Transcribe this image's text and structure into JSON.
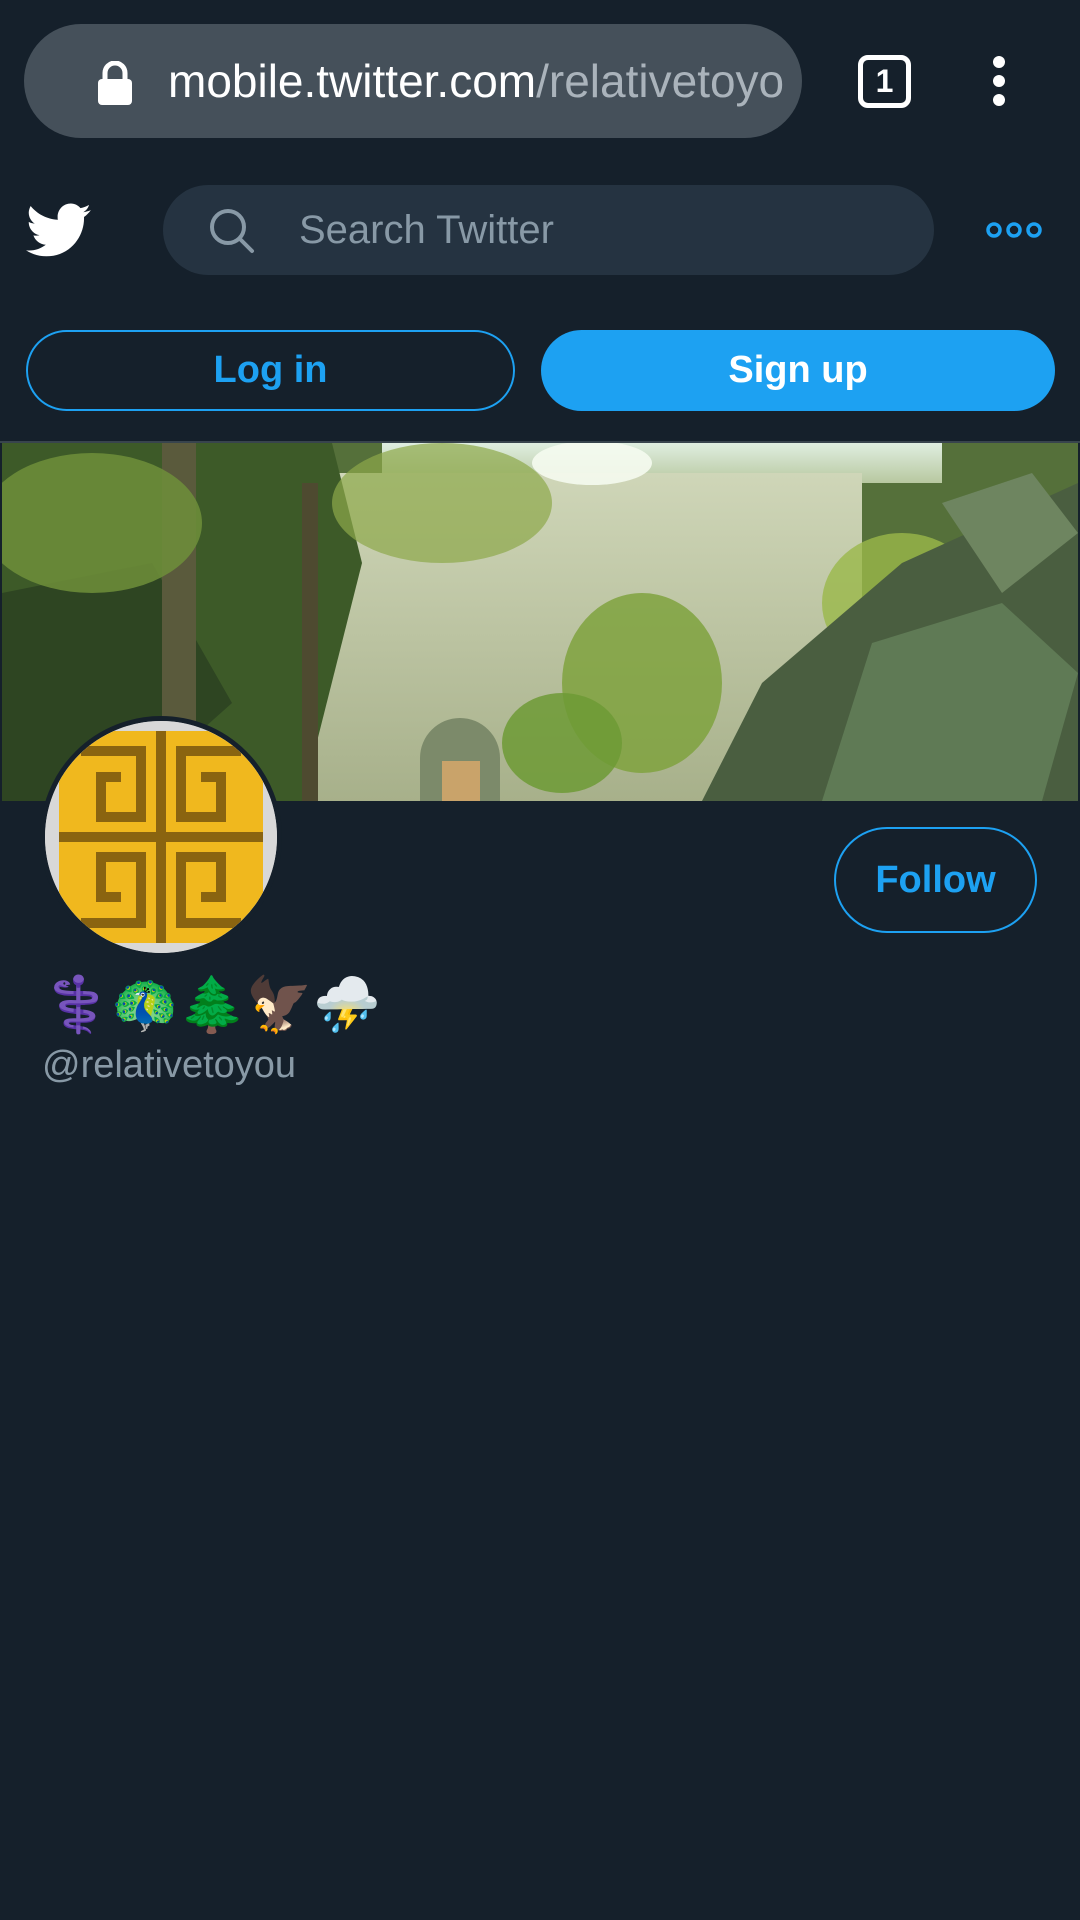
{
  "browser": {
    "url_host": "mobile.twitter.com",
    "url_path": "/relativetoyo",
    "tab_count": "1",
    "icons": [
      "lock-icon",
      "tab-switcher-icon",
      "kebab-menu-icon"
    ]
  },
  "header": {
    "search_placeholder": "Search Twitter",
    "icons": [
      "twitter-logo-icon",
      "search-icon",
      "more-options-icon"
    ]
  },
  "auth": {
    "login_label": "Log in",
    "signup_label": "Sign up"
  },
  "profile": {
    "display_name": "⚕️🦚🌲🦅⛈️",
    "handle": "@relativetoyou",
    "follow_label": "Follow"
  },
  "colors": {
    "background": "#15202b",
    "accent": "#1da1f2",
    "url_pill": "#45505a",
    "search_box": "#253341",
    "secondary_text": "#8899a6"
  }
}
